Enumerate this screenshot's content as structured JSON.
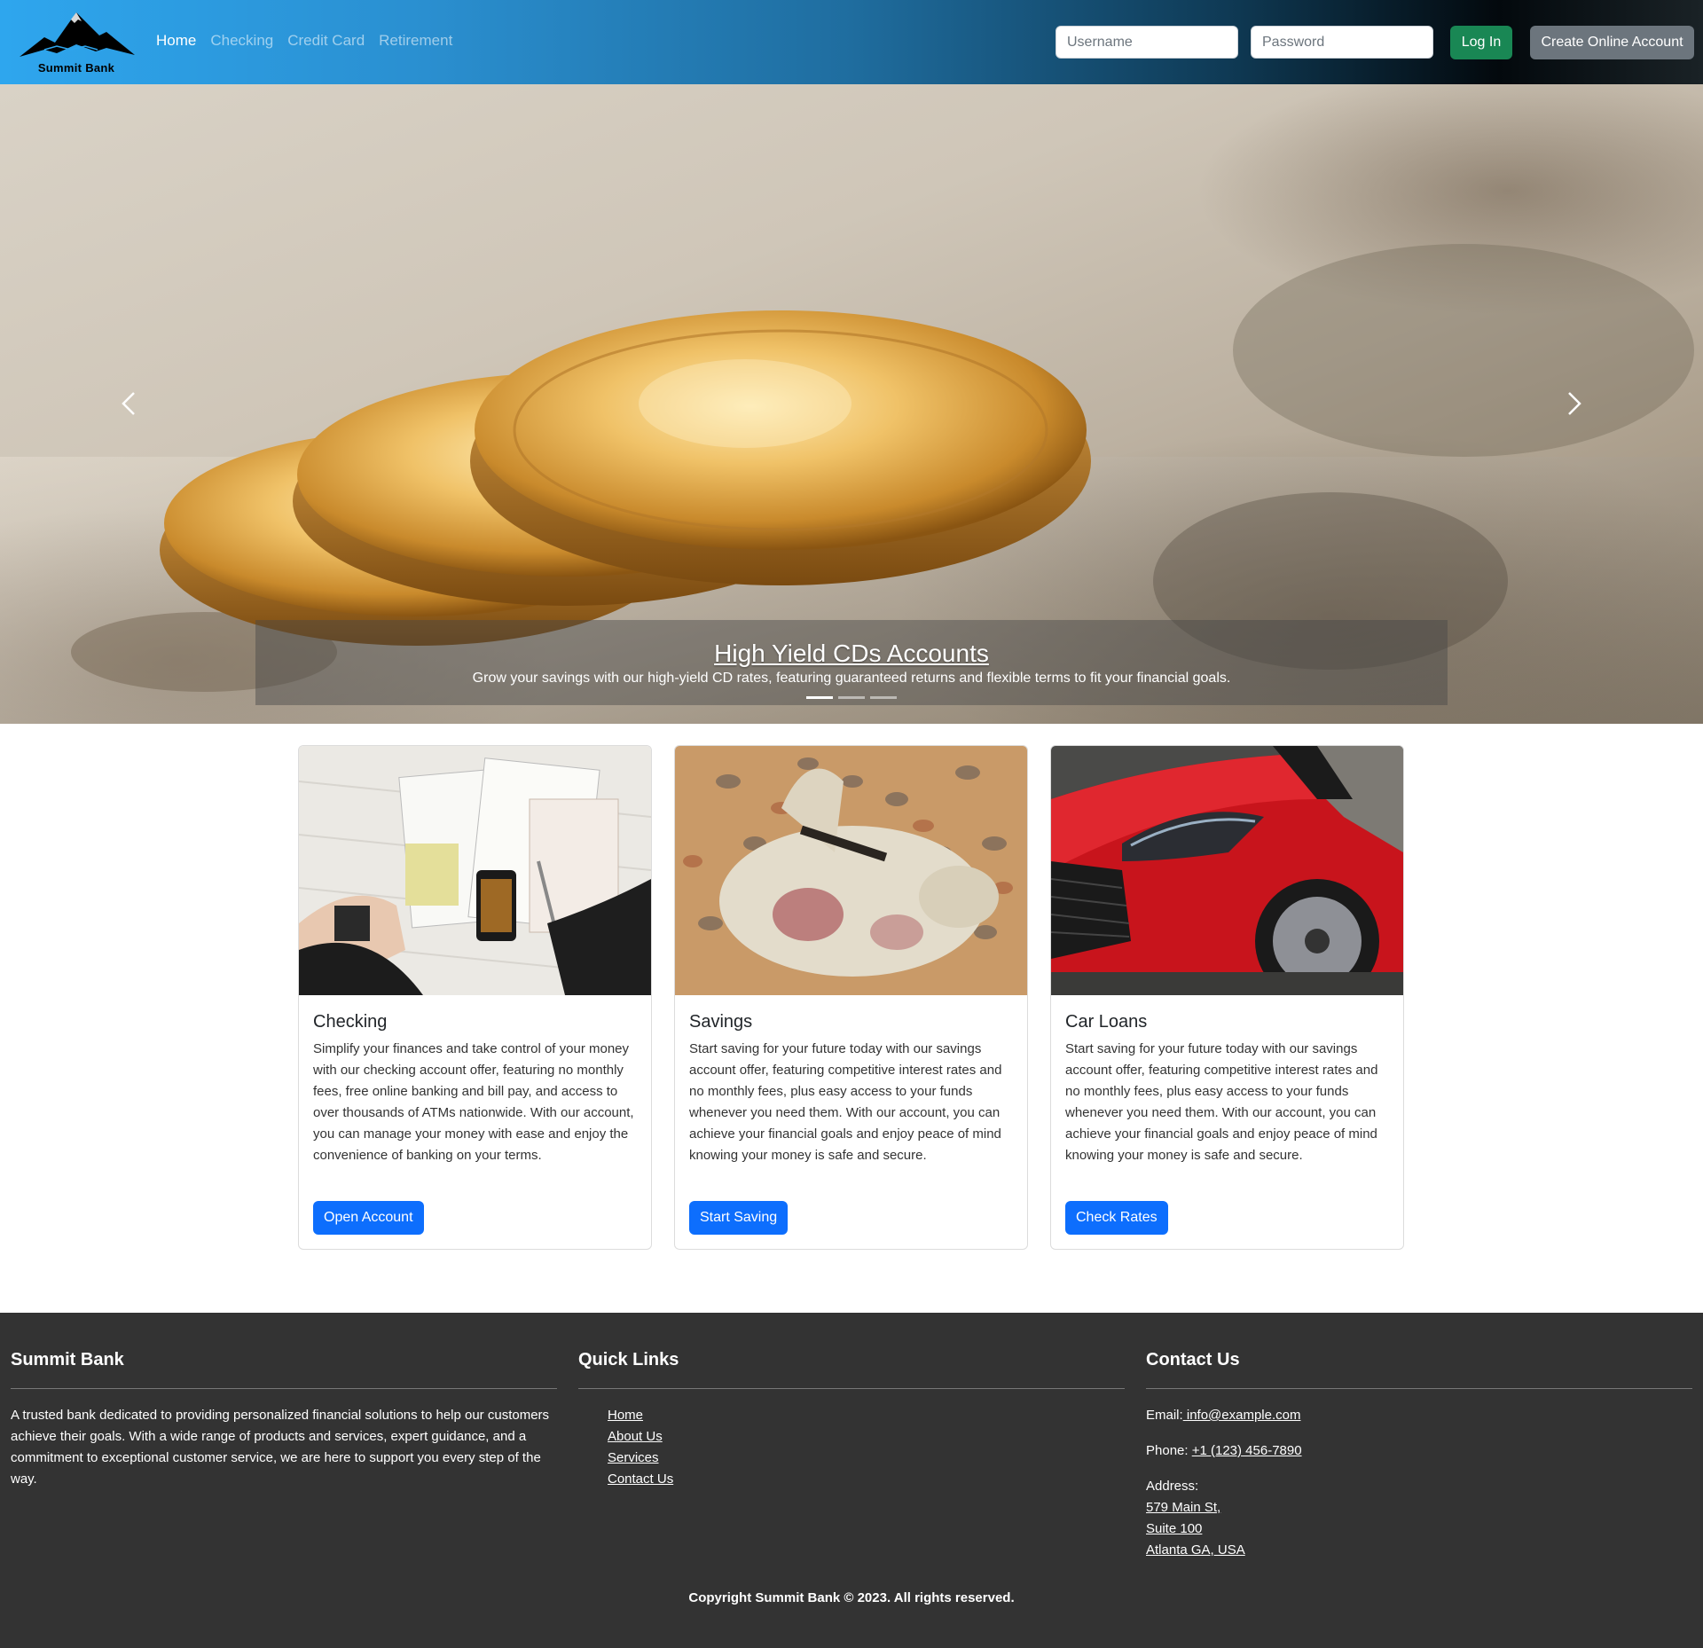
{
  "brand": {
    "name": "Summit Bank"
  },
  "nav": {
    "links": [
      {
        "label": "Home",
        "active": true
      },
      {
        "label": "Checking",
        "active": false
      },
      {
        "label": "Credit Card",
        "active": false
      },
      {
        "label": "Retirement",
        "active": false
      }
    ]
  },
  "login": {
    "username_placeholder": "Username",
    "password_placeholder": "Password",
    "login_label": "Log In",
    "create_label": "Create Online Account"
  },
  "carousel": {
    "title": "High Yield CDs Accounts",
    "text": "Grow your savings with our high-yield CD rates, featuring guaranteed returns and flexible terms to fit your financial goals.",
    "slide_count": 3,
    "active_slide": 1
  },
  "cards": [
    {
      "title": "Checking",
      "text": "Simplify your finances and take control of your money with our checking account offer, featuring no monthly fees, free online banking and bill pay, and access to over thousands of ATMs nationwide. With our account, you can manage your money with ease and enjoy the convenience of banking on your terms.",
      "button": "Open Account"
    },
    {
      "title": "Savings",
      "text": "Start saving for your future today with our savings account offer, featuring competitive interest rates and no monthly fees, plus easy access to your funds whenever you need them. With our account, you can achieve your financial goals and enjoy peace of mind knowing your money is safe and secure.",
      "button": "Start Saving"
    },
    {
      "title": "Car Loans",
      "text": "Start saving for your future today with our savings account offer, featuring competitive interest rates and no monthly fees, plus easy access to your funds whenever you need them. With our account, you can achieve your financial goals and enjoy peace of mind knowing your money is safe and secure.",
      "button": "Check Rates"
    }
  ],
  "footer": {
    "about": {
      "heading": "Summit Bank",
      "text": "A trusted bank dedicated to providing personalized financial solutions to help our customers achieve their goals. With a wide range of products and services, expert guidance, and a commitment to exceptional customer service, we are here to support you every step of the way."
    },
    "quick_links": {
      "heading": "Quick Links",
      "items": [
        "Home",
        "About Us",
        "Services",
        "Contact Us"
      ]
    },
    "contact": {
      "heading": "Contact Us",
      "email_label": "Email:",
      "email": " info@example.com",
      "phone_label": "Phone: ",
      "phone": "+1 (123) 456-7890",
      "address_label": "Address:",
      "address_lines": [
        "579 Main St,",
        "Suite 100",
        "Atlanta GA, USA"
      ]
    },
    "copyright": "Copyright Summit Bank © 2023. All rights reserved."
  },
  "colors": {
    "nav_gradient_start": "#2ea6ee",
    "nav_gradient_end": "#03090d",
    "login_button": "#198754",
    "create_button": "#6c757d",
    "primary_button": "#0d6efd",
    "footer_bg": "#333333"
  }
}
